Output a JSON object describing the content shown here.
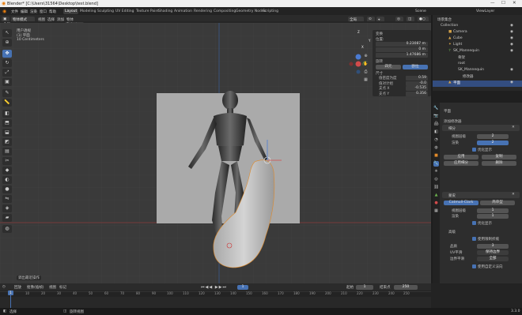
{
  "window": {
    "title": "Blender* [C:\\Users\\31564\\Desktop\\test.blend]"
  },
  "menus": [
    "文件",
    "编辑",
    "渲染",
    "窗口",
    "帮助"
  ],
  "workspaces": [
    "Layout",
    "Modeling",
    "Sculpting",
    "UV Editing",
    "Texture Paint",
    "Shading",
    "Animation",
    "Rendering",
    "Compositing",
    "Geometry Nodes",
    "Scripting"
  ],
  "top_right": {
    "scene": "Scene",
    "view_layer": "ViewLayer"
  },
  "header": {
    "mode": "物体模式",
    "view": "视图",
    "select": "选择",
    "add": "添加",
    "object": "物体",
    "orientation": "全局",
    "select_box": "Select Box"
  },
  "viewport_overlay_text": [
    "用户透视",
    "(1) 平面",
    "10 Centimeters"
  ],
  "gizmo": {
    "x": "X",
    "y": "Y",
    "z": "Z"
  },
  "npanel": {
    "title": "变换",
    "location_label": "位置:",
    "location": [
      "0.23087 m",
      "0 m",
      "1.47686 m"
    ],
    "rot_label": "旋转",
    "mode_options": [
      "四元",
      "欧拉"
    ],
    "scale_label": "尺寸",
    "rows": [
      {
        "label": "值密度为度",
        "value": "0.59"
      },
      {
        "label": "值对计组",
        "value": "-0.0"
      },
      {
        "label": "支点 X",
        "value": "-0.535"
      },
      {
        "label": "支点 Y",
        "value": "0.356"
      }
    ]
  },
  "outliner": {
    "title": "场景集合",
    "items": [
      {
        "label": "Collection",
        "depth": 1
      },
      {
        "label": "Camera",
        "depth": 2
      },
      {
        "label": "Cube",
        "depth": 2
      },
      {
        "label": "Light",
        "depth": 2
      },
      {
        "label": "SK_Mannequin",
        "depth": 2
      },
      {
        "label": "骨架",
        "depth": 3
      },
      {
        "label": "root",
        "depth": 3
      },
      {
        "label": "SK_Mannequin",
        "depth": 3
      },
      {
        "label": "修改器",
        "depth": 4
      },
      {
        "label": "平面",
        "depth": 2,
        "selected": true
      }
    ]
  },
  "properties": {
    "object_name": "平面",
    "modifier_header": "添加修改器",
    "mod1_name": "细分",
    "subdiv_fields": [
      {
        "label": "视图层级",
        "value": "2"
      },
      {
        "label": "渲染",
        "value": "2"
      }
    ],
    "subdiv_check": "优化显示",
    "apply_btns": [
      "应用",
      "复制",
      "应用细分",
      "删除"
    ],
    "mod2_name": "蒙皮",
    "mod2_tabs": [
      "Catmull-Clark",
      "简单型"
    ],
    "levels": [
      {
        "label": "视图层级",
        "value": "1"
      },
      {
        "label": "渲染",
        "value": "1"
      }
    ],
    "opt_check": "优化显示",
    "advanced": "高级",
    "checks": [
      "使用限制折痕",
      "使用自定义法向"
    ],
    "adv_fields": [
      {
        "label": "品质",
        "value": "3"
      },
      {
        "label": "UV平滑",
        "value": "保持边界"
      },
      {
        "label": "边界平滑",
        "value": "全部"
      }
    ]
  },
  "timeline": {
    "menus": [
      "回放",
      "抠像(插帧)",
      "视图",
      "标记"
    ],
    "current_frame": "1",
    "start_label": "起始",
    "start": "1",
    "end_label": "结束点",
    "end": "250",
    "ticks": [
      "0",
      "10",
      "20",
      "30",
      "40",
      "50",
      "60",
      "70",
      "80",
      "90",
      "100",
      "110",
      "120",
      "130",
      "140",
      "150",
      "160",
      "170",
      "180",
      "190",
      "200",
      "210",
      "220",
      "230",
      "240",
      "250"
    ]
  },
  "status": {
    "left": "选择",
    "middle": "旋转视图",
    "right": "3.3.0"
  },
  "popup_hint": "调出最近操作",
  "colors": {
    "accent": "#4772b3",
    "selected_row": "#334d80",
    "viewport_bg": "#3a3a3a",
    "camera_plane": "#aaaaaa"
  }
}
